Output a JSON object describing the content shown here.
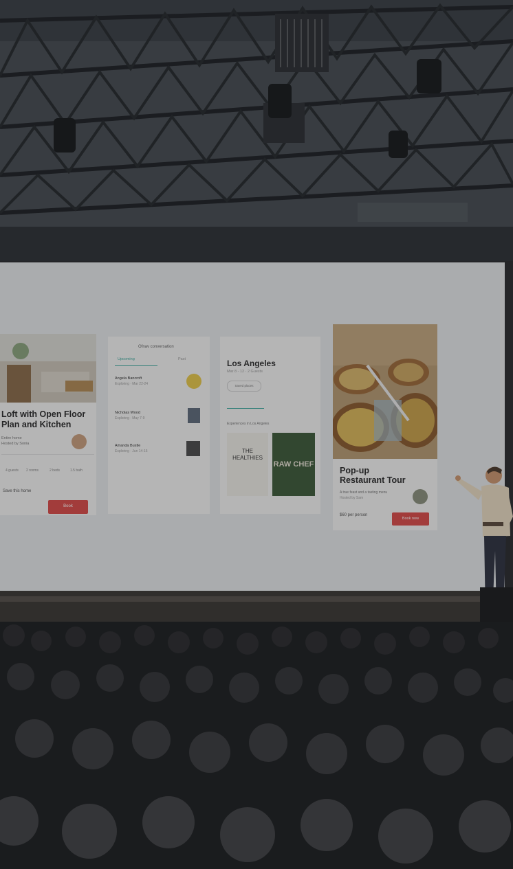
{
  "slide": {
    "card_left": {
      "title_line1": "Loft with Open Floor",
      "title_line2": "Plan and Kitchen",
      "subtitle_line1": "Entire home",
      "subtitle_line2": "Hosted by Sonia",
      "amenities": [
        "4 guests",
        "2 rooms",
        "2 beds",
        "1.5 bath"
      ],
      "section_label": "Save this home",
      "cta_label": "Book"
    },
    "card_messages": {
      "header": "Ofnav conversation",
      "tabs": [
        "Upcoming",
        "Past"
      ],
      "items": [
        {
          "name": "Angela Bancroft",
          "line": "Exploring · Mar 22-24"
        },
        {
          "name": "Nicholas Wood",
          "line": "Exploring · May 7-9"
        },
        {
          "name": "Amanda Bustle",
          "line": "Exploring · Jun 14-16"
        }
      ]
    },
    "card_city": {
      "title": "Los Angeles",
      "subtitle": "Mar 8 - 12 · 2 Guests",
      "chip": "Saved places",
      "section_label": "Experiences in Los Angeles",
      "book1_title": "THE HEALTHIES",
      "book2_title": "RAW CHEF"
    },
    "card_restaurant": {
      "title_line1": "Pop-up",
      "title_line2": "Restaurant Tour",
      "meta_line1": "A true feast and a tasting menu",
      "meta_line2": "Hosted by Sam",
      "price": "$60 per person",
      "cta_label": "Book now"
    }
  },
  "colors": {
    "cta": "#d94b48",
    "accent_teal": "#3aa79a",
    "screen": "#e4e7e8",
    "ceiling": "#3c4146",
    "audience": "#1d1f21"
  }
}
